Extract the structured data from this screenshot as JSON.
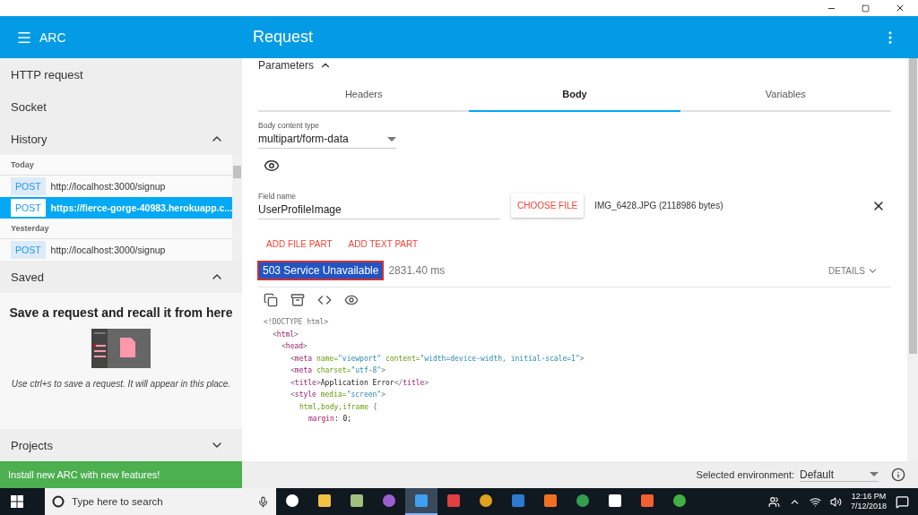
{
  "app_bar": {
    "menu_title": "ARC",
    "title": "Request"
  },
  "sidebar": {
    "items": [
      {
        "label": "HTTP request"
      },
      {
        "label": "Socket"
      }
    ],
    "history": {
      "title": "History",
      "expanded": true,
      "groups": [
        {
          "label": "Today",
          "entries": [
            {
              "method": "POST",
              "url": "http://localhost:3000/signup",
              "selected": false
            },
            {
              "method": "POST",
              "url": "https://fierce-gorge-40983.herokuapp.c...",
              "selected": true
            }
          ]
        },
        {
          "label": "Yesterday",
          "entries": [
            {
              "method": "POST",
              "url": "http://localhost:3000/signup",
              "selected": false
            }
          ]
        }
      ]
    },
    "saved": {
      "title": "Saved",
      "expanded": true,
      "heading": "Save a request and recall it from here",
      "hint": "Use ctrl+s to save a request. It will appear in this place."
    },
    "projects": {
      "title": "Projects",
      "expanded": false
    },
    "banner": "Install new ARC with new features!"
  },
  "request": {
    "parameters": {
      "label": "Parameters",
      "expanded": true
    },
    "tabs": [
      {
        "label": "Headers",
        "selected": false
      },
      {
        "label": "Body",
        "selected": true
      },
      {
        "label": "Variables",
        "selected": false
      }
    ],
    "body_content_type": {
      "label": "Body content type",
      "value": "multipart/form-data"
    },
    "field": {
      "label": "Field name",
      "value": "UserProfileImage"
    },
    "choose_file": "CHOOSE FILE",
    "file_info": "IMG_6428.JPG (2118986 bytes)",
    "add_buttons": [
      "ADD FILE PART",
      "ADD TEXT PART"
    ],
    "status": "503 Service Unavailable",
    "time": "2831.40 ms",
    "details": "DETAILS",
    "code": [
      {
        "tokens": [
          {
            "kind": "punct",
            "text": "<!DOCTYPE html>"
          }
        ],
        "children": [
          {
            "tokens": [
              {
                "kind": "punct",
                "text": "<"
              },
              {
                "kind": "tag",
                "text": "html"
              },
              {
                "kind": "punct",
                "text": ">"
              }
            ],
            "children": [
              {
                "tokens": [
                  {
                    "kind": "punct",
                    "text": "<"
                  },
                  {
                    "kind": "tag",
                    "text": "head"
                  },
                  {
                    "kind": "punct",
                    "text": ">"
                  }
                ],
                "children": [
                  {
                    "tokens": [
                      {
                        "kind": "punct",
                        "text": "<"
                      },
                      {
                        "kind": "tag",
                        "text": "meta"
                      },
                      {
                        "kind": "attr",
                        "text": " name="
                      },
                      {
                        "kind": "value",
                        "text": "\"viewport\""
                      },
                      {
                        "kind": "attr",
                        "text": " content="
                      },
                      {
                        "kind": "value",
                        "text": "\"width=device-width, initial-scale=1\""
                      },
                      {
                        "kind": "punct",
                        "text": ">"
                      }
                    ]
                  },
                  {
                    "tokens": [
                      {
                        "kind": "punct",
                        "text": "<"
                      },
                      {
                        "kind": "tag",
                        "text": "meta"
                      },
                      {
                        "kind": "attr",
                        "text": " charset="
                      },
                      {
                        "kind": "value",
                        "text": "\"utf-8\""
                      },
                      {
                        "kind": "punct",
                        "text": ">"
                      }
                    ]
                  },
                  {
                    "tokens": [
                      {
                        "kind": "punct",
                        "text": "<"
                      },
                      {
                        "kind": "tag",
                        "text": "title"
                      },
                      {
                        "kind": "punct",
                        "text": ">"
                      },
                      {
                        "kind": "text",
                        "text": "Application Error"
                      },
                      {
                        "kind": "punct",
                        "text": "</"
                      },
                      {
                        "kind": "tag",
                        "text": "title"
                      },
                      {
                        "kind": "punct",
                        "text": ">"
                      }
                    ]
                  },
                  {
                    "tokens": [
                      {
                        "kind": "punct",
                        "text": "<"
                      },
                      {
                        "kind": "tag",
                        "text": "style"
                      },
                      {
                        "kind": "attr",
                        "text": " media="
                      },
                      {
                        "kind": "value",
                        "text": "\"screen\""
                      },
                      {
                        "kind": "punct",
                        "text": ">"
                      }
                    ],
                    "children": [
                      {
                        "tokens": [
                          {
                            "kind": "attr",
                            "text": "html,body,iframe"
                          },
                          {
                            "kind": "punct",
                            "text": " {"
                          }
                        ],
                        "children": [
                          {
                            "tokens": [
                              {
                                "kind": "tag",
                                "text": "margin"
                              },
                              {
                                "kind": "text",
                                "text": ": 0;"
                              }
                            ]
                          }
                        ]
                      }
                    ]
                  }
                ]
              }
            ]
          }
        ]
      }
    ],
    "environment": {
      "label": "Selected environment:",
      "value": "Default"
    }
  },
  "taskbar": {
    "search_placeholder": "Type here to search",
    "apps": [
      {
        "selected": false
      },
      {
        "selected": false
      },
      {
        "selected": false
      },
      {
        "selected": false
      },
      {
        "selected": true
      },
      {
        "selected": false
      },
      {
        "selected": false
      },
      {
        "selected": false
      },
      {
        "selected": false
      },
      {
        "selected": false
      },
      {
        "selected": false
      },
      {
        "selected": false
      },
      {
        "selected": false
      }
    ],
    "time": "12:16 PM",
    "date": "7/12/2018"
  }
}
